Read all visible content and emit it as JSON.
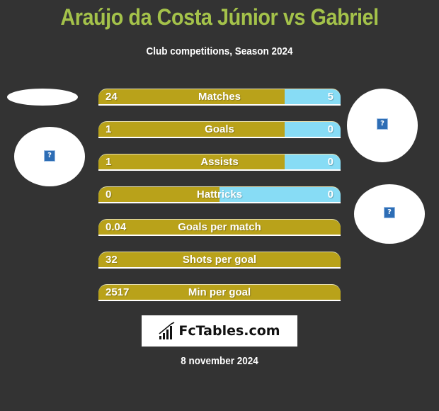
{
  "header": {
    "title": "Araújo da Costa Júnior vs Gabriel",
    "subtitle": "Club competitions, Season 2024"
  },
  "colors": {
    "title": "#a4c24a",
    "left_bar": "#b9a21a",
    "right_bar": "#87dcf5",
    "background": "#333333"
  },
  "players": {
    "left": {
      "image_icon": "broken-image-icon"
    },
    "right": {
      "image_icon": "broken-image-icon"
    }
  },
  "stats": [
    {
      "label": "Matches",
      "left": "24",
      "right": "5",
      "left_share": 0.77
    },
    {
      "label": "Goals",
      "left": "1",
      "right": "0",
      "left_share": 0.77
    },
    {
      "label": "Assists",
      "left": "1",
      "right": "0",
      "left_share": 0.77
    },
    {
      "label": "Hattricks",
      "left": "0",
      "right": "0",
      "left_share": 0.5
    },
    {
      "label": "Goals per match",
      "left": "0.04",
      "right": "",
      "left_share": 1.0
    },
    {
      "label": "Shots per goal",
      "left": "32",
      "right": "",
      "left_share": 1.0
    },
    {
      "label": "Min per goal",
      "left": "2517",
      "right": "",
      "left_share": 1.0
    }
  ],
  "logo": {
    "text": "FcTables.com",
    "icon": "bar-chart-icon"
  },
  "footer": {
    "date": "8 november 2024"
  }
}
